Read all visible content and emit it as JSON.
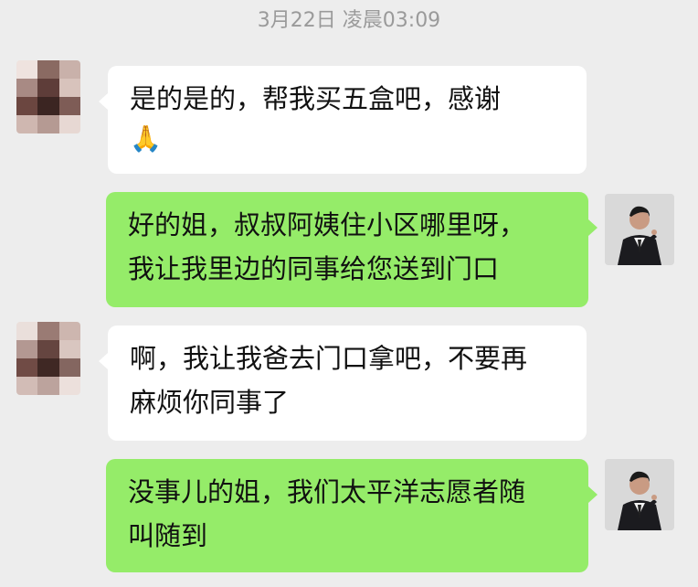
{
  "timestamp": "3月22日 凌晨03:09",
  "messages": [
    {
      "lines": [
        "是的是的，帮我买五盒吧，感谢"
      ],
      "emoji": "🙏"
    },
    {
      "lines": [
        "好的姐，叔叔阿姨住小区哪里呀，",
        "我让我里边的同事给您送到门口"
      ]
    },
    {
      "lines": [
        "啊，我让我爸去门口拿吧，不要再",
        "麻烦你同事了"
      ]
    },
    {
      "lines": [
        "没事儿的姐，我们太平洋志愿者随",
        "叫随到"
      ]
    }
  ],
  "colors": {
    "background": "#ededed",
    "incoming_bubble": "#ffffff",
    "outgoing_bubble": "#95ec69",
    "timestamp_text": "#9a9a9a"
  },
  "icons": {
    "incoming_avatar": "blurred-mosaic-avatar",
    "outgoing_avatar": "man-in-suit-avatar",
    "emoji": "folded-hands-icon"
  }
}
